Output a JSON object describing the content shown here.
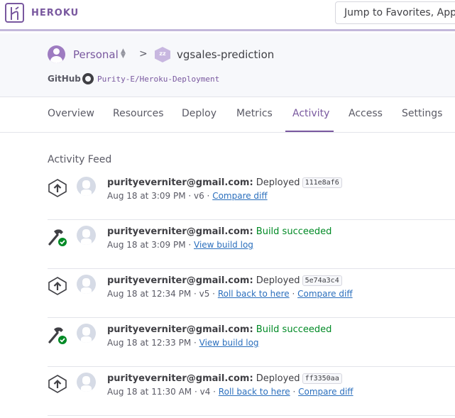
{
  "topbar": {
    "brand": "HEROKU",
    "jump_placeholder": "Jump to Favorites, Apps"
  },
  "header": {
    "account": "Personal",
    "separator": ">",
    "app_name": "vgsales-prediction",
    "github_label": "GitHub",
    "github_repo": "Purity-E/Heroku-Deployment"
  },
  "tabs": [
    "Overview",
    "Resources",
    "Deploy",
    "Metrics",
    "Activity",
    "Access",
    "Settings"
  ],
  "active_tab": "Activity",
  "feed": {
    "title": "Activity Feed",
    "items": [
      {
        "icon": "deploy-icon",
        "email": "purityeverniter@gmail.com:",
        "action": "Deployed",
        "hash": "111e8af6",
        "meta": "Aug 18 at 3:09 PM · v6 · ",
        "links": [
          "Compare diff"
        ]
      },
      {
        "icon": "build-success-icon",
        "email": "purityeverniter@gmail.com:",
        "action": "Build succeeded",
        "hash": "",
        "meta": "Aug 18 at 3:09 PM · ",
        "links": [
          "View build log"
        ]
      },
      {
        "icon": "deploy-icon",
        "email": "purityeverniter@gmail.com:",
        "action": "Deployed",
        "hash": "5e74a3c4",
        "meta": "Aug 18 at 12:34 PM · v5 · ",
        "links": [
          "Roll back to here",
          "Compare diff"
        ]
      },
      {
        "icon": "build-success-icon",
        "email": "purityeverniter@gmail.com:",
        "action": "Build succeeded",
        "hash": "",
        "meta": "Aug 18 at 12:33 PM · ",
        "links": [
          "View build log"
        ]
      },
      {
        "icon": "deploy-icon",
        "email": "purityeverniter@gmail.com:",
        "action": "Deployed",
        "hash": "ff3350aa",
        "meta": "Aug 18 at 11:30 AM · v4 · ",
        "links": [
          "Roll back to here",
          "Compare diff"
        ]
      }
    ]
  },
  "colors": {
    "brand": "#79589f",
    "success": "#008a25",
    "link": "#2b6fbd"
  }
}
